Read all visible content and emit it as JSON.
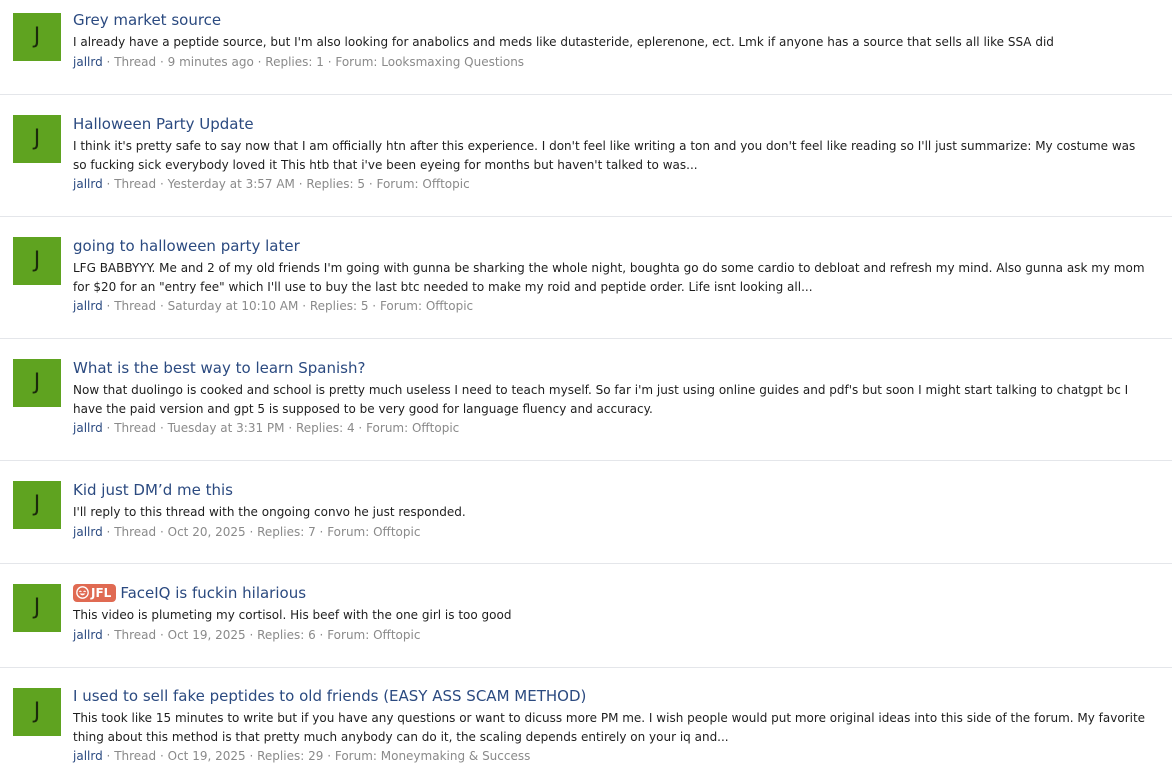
{
  "colors": {
    "avatar_bg": "#5fa320",
    "title_link": "#2b4a80",
    "meta_text": "#8a8a8a",
    "prefix_bg": "#e06a52"
  },
  "threads": [
    {
      "avatar_letter": "J",
      "title": "Grey market source",
      "snippet": "I already have a peptide source, but I'm also looking for anabolics and meds like dutasteride, eplerenone, ect. Lmk if anyone has a source that sells all like SSA did",
      "author": "jallrd",
      "type": "Thread",
      "time": "9 minutes ago",
      "replies": "Replies: 1",
      "forum": "Forum: Looksmaxing Questions"
    },
    {
      "avatar_letter": "J",
      "title": "Halloween Party Update",
      "snippet": "I think it's pretty safe to say now that I am officially htn after this experience. I don't feel like writing a ton and you don't feel like reading so I'll just summarize: My costume was so fucking sick everybody loved it This htb that i've been eyeing for months but haven't talked to was...",
      "author": "jallrd",
      "type": "Thread",
      "time": "Yesterday at 3:57 AM",
      "replies": "Replies: 5",
      "forum": "Forum: Offtopic"
    },
    {
      "avatar_letter": "J",
      "title": "going to halloween party later",
      "snippet": "LFG BABBYYY. Me and 2 of my old friends I'm going with gunna be sharking the whole night, boughta go do some cardio to debloat and refresh my mind. Also gunna ask my mom for $20 for an \"entry fee\" which I'll use to buy the last btc needed to make my roid and peptide order. Life isnt looking all...",
      "author": "jallrd",
      "type": "Thread",
      "time": "Saturday at 10:10 AM",
      "replies": "Replies: 5",
      "forum": "Forum: Offtopic"
    },
    {
      "avatar_letter": "J",
      "title": "What is the best way to learn Spanish?",
      "snippet": "Now that duolingo is cooked and school is pretty much useless I need to teach myself. So far i'm just using online guides and pdf's but soon I might start talking to chatgpt bc I have the paid version and gpt 5 is supposed to be very good for language fluency and accuracy.",
      "author": "jallrd",
      "type": "Thread",
      "time": "Tuesday at 3:31 PM",
      "replies": "Replies: 4",
      "forum": "Forum: Offtopic"
    },
    {
      "avatar_letter": "J",
      "title": "Kid just DM’d me this",
      "snippet": "I'll reply to this thread with the ongoing convo he just responded.",
      "author": "jallrd",
      "type": "Thread",
      "time": "Oct 20, 2025",
      "replies": "Replies: 7",
      "forum": "Forum: Offtopic"
    },
    {
      "avatar_letter": "J",
      "prefix": "JFL",
      "prefix_icon": "laughing-face-icon",
      "title": "FaceIQ is fuckin hilarious",
      "snippet": "This video is plumeting my cortisol. His beef with the one girl is too good",
      "author": "jallrd",
      "type": "Thread",
      "time": "Oct 19, 2025",
      "replies": "Replies: 6",
      "forum": "Forum: Offtopic"
    },
    {
      "avatar_letter": "J",
      "title": "I used to sell fake peptides to old friends (EASY ASS SCAM METHOD)",
      "snippet": "This took like 15 minutes to write but if you have any questions or want to dicuss more PM me. I wish people would put more original ideas into this side of the forum. My favorite thing about this method is that pretty much anybody can do it, the scaling depends entirely on your iq and...",
      "author": "jallrd",
      "type": "Thread",
      "time": "Oct 19, 2025",
      "replies": "Replies: 29",
      "forum": "Forum: Moneymaking & Success"
    }
  ]
}
